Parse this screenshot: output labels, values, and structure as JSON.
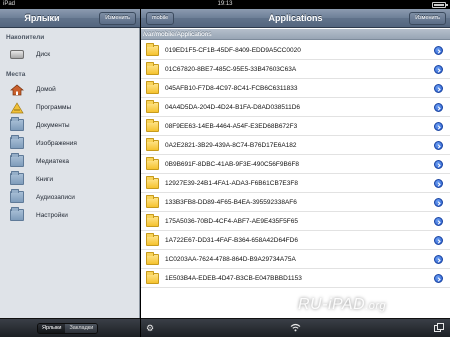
{
  "statusbar": {
    "carrier": "iPad",
    "time": "19:13",
    "battery_level": 0.95
  },
  "sidebar": {
    "title": "Ярлыки",
    "edit_label": "Изменить",
    "section_drives": "Накопители",
    "disk_label": "Диск",
    "section_places": "Места",
    "places": [
      {
        "label": "Домой",
        "icon": "home-icon"
      },
      {
        "label": "Программы",
        "icon": "applications-icon"
      },
      {
        "label": "Документы",
        "icon": "folder-icon"
      },
      {
        "label": "Изображения",
        "icon": "folder-icon"
      },
      {
        "label": "Медиатека",
        "icon": "folder-icon"
      },
      {
        "label": "Книги",
        "icon": "folder-icon"
      },
      {
        "label": "Аудиозаписи",
        "icon": "folder-icon"
      },
      {
        "label": "Настройки",
        "icon": "folder-icon"
      }
    ],
    "footer": {
      "tab_shortcuts": "Ярлыки",
      "tab_bookmarks": "Закладки"
    }
  },
  "main": {
    "back_label": "mobile",
    "title": "Applications",
    "edit_label": "Изменить",
    "path": "/var/mobile/Applications",
    "rows": [
      "019ED1F5-CF1B-45DF-8409-EDD9A5CC0020",
      "01C67820-8BE7-485C-95E5-33B47603C63A",
      "045AFB10-F7D8-4C97-8C41-FCB6C6311833",
      "04A4D5DA-204D-4D24-B1FA-D8AD038511D6",
      "08F9EE63-14EB-4464-A54F-E3ED68B672F3",
      "0A2E2821-3B29-439A-8C74-B76D17E6A182",
      "0B9B691F-8DBC-41AB-9F3E-490C56F9B6F8",
      "12927E39-24B1-4FA1-ADA3-F6B61CB7E3F8",
      "133B3FB8-DD89-4F65-B4EA-395592338AF6",
      "175A5036-70BD-4CF4-ABF7-AE9E435F5F65",
      "1A722E67-DD31-4FAF-B364-658A42D64FD6",
      "1C0203AA-7624-4788-864D-B9A29734A75A",
      "1E503B4A-EDEB-4D47-B3CB-E047BBBD1153"
    ]
  },
  "watermark": {
    "text": "RU-iPAD",
    "suffix": ".org"
  }
}
